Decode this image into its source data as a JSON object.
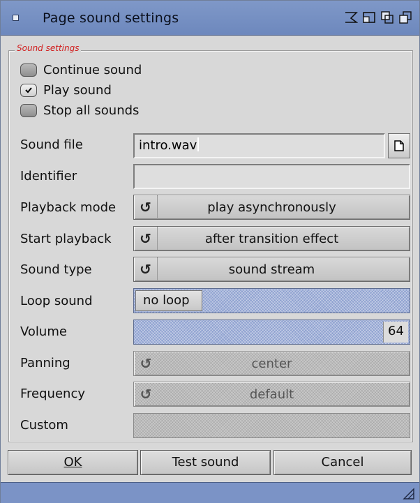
{
  "window": {
    "title": "Page sound settings",
    "colors": {
      "titlebar": "#7891c5",
      "group_title": "#d11d1d",
      "slider_fill": "#8da0cf"
    }
  },
  "group": {
    "title": "Sound settings"
  },
  "options": [
    {
      "label": "Continue sound",
      "checked": false
    },
    {
      "label": "Play sound",
      "checked": true
    },
    {
      "label": "Stop all sounds",
      "checked": false
    }
  ],
  "fields": {
    "sound_file": {
      "label": "Sound file",
      "value": "intro.wav"
    },
    "identifier": {
      "label": "Identifier",
      "value": ""
    },
    "playback_mode": {
      "label": "Playback mode",
      "value": "play asynchronously"
    },
    "start_playback": {
      "label": "Start playback",
      "value": "after transition effect"
    },
    "sound_type": {
      "label": "Sound type",
      "value": "sound stream"
    },
    "loop_sound": {
      "label": "Loop sound",
      "value": "no loop"
    },
    "volume": {
      "label": "Volume",
      "value": "64"
    },
    "panning": {
      "label": "Panning",
      "value": "center"
    },
    "frequency": {
      "label": "Frequency",
      "value": "default"
    },
    "custom": {
      "label": "Custom",
      "value": ""
    }
  },
  "buttons": {
    "ok": "OK",
    "test": "Test sound",
    "cancel": "Cancel"
  },
  "icons": {
    "close": "close-gadget-icon",
    "iconify": "iconify-icon",
    "zoom": "zoom-icon",
    "depth": "depth-icon",
    "file": "file-requester-icon",
    "cycle": "cycle-icon",
    "resize": "resize-icon"
  }
}
